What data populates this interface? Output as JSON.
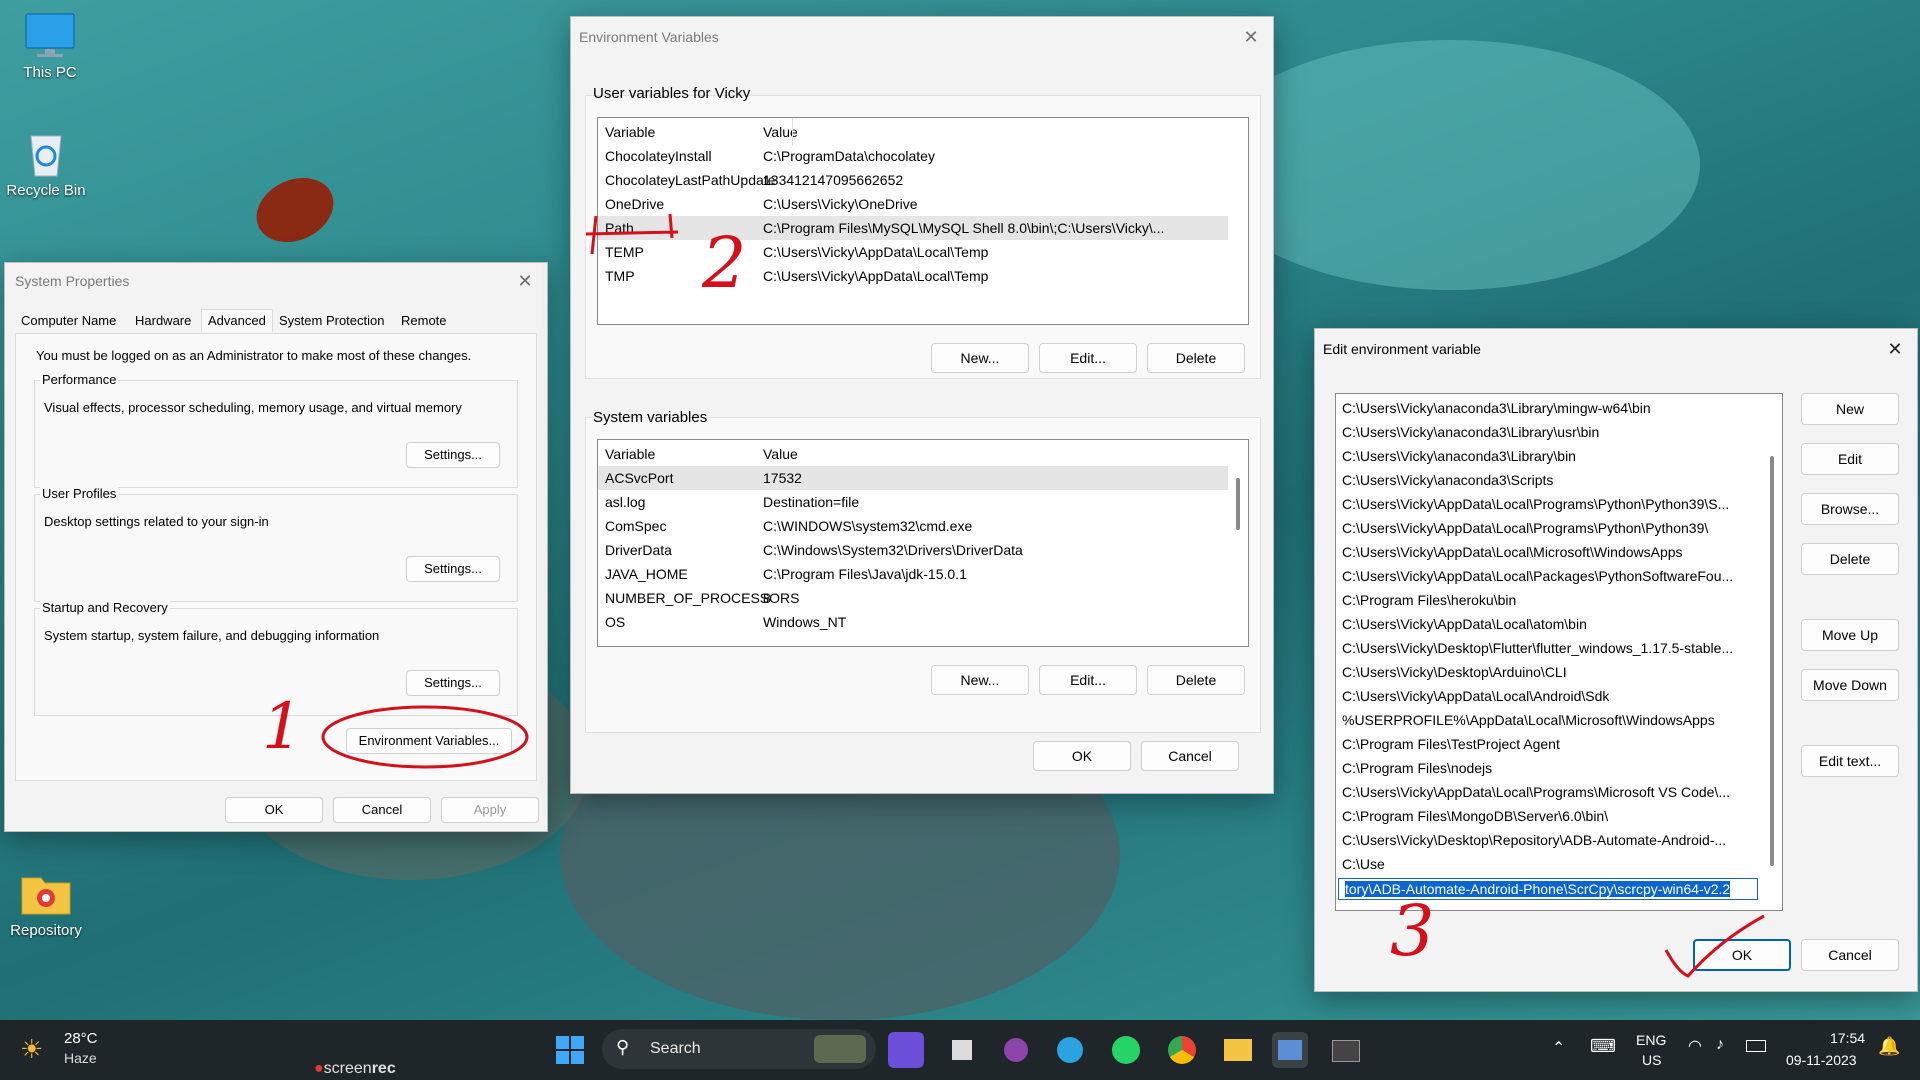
{
  "desktop": {
    "icons": [
      {
        "label": "This PC",
        "icon": "monitor-icon"
      },
      {
        "label": "Recycle Bin",
        "icon": "recycle-bin-icon"
      },
      {
        "label": "Repository",
        "icon": "folder-icon"
      }
    ]
  },
  "system_properties": {
    "title": "System Properties",
    "tabs": [
      "Computer Name",
      "Hardware",
      "Advanced",
      "System Protection",
      "Remote"
    ],
    "active_tab": "Advanced",
    "admin_note": "You must be logged on as an Administrator to make most of these changes.",
    "performance": {
      "title": "Performance",
      "desc": "Visual effects, processor scheduling, memory usage, and virtual memory",
      "button": "Settings..."
    },
    "user_profiles": {
      "title": "User Profiles",
      "desc": "Desktop settings related to your sign-in",
      "button": "Settings..."
    },
    "startup": {
      "title": "Startup and Recovery",
      "desc": "System startup, system failure, and debugging information",
      "button": "Settings..."
    },
    "env_button": "Environment Variables...",
    "ok": "OK",
    "cancel": "Cancel",
    "apply": "Apply"
  },
  "env_vars": {
    "title": "Environment Variables",
    "user_section": "User variables for Vicky",
    "system_section": "System variables",
    "col_variable": "Variable",
    "col_value": "Value",
    "user_rows": [
      {
        "name": "ChocolateyInstall",
        "value": "C:\\ProgramData\\chocolatey"
      },
      {
        "name": "ChocolateyLastPathUpdate",
        "value": "133412147095662652"
      },
      {
        "name": "OneDrive",
        "value": "C:\\Users\\Vicky\\OneDrive"
      },
      {
        "name": "Path",
        "value": "C:\\Program Files\\MySQL\\MySQL Shell 8.0\\bin\\;C:\\Users\\Vicky\\..."
      },
      {
        "name": "TEMP",
        "value": "C:\\Users\\Vicky\\AppData\\Local\\Temp"
      },
      {
        "name": "TMP",
        "value": "C:\\Users\\Vicky\\AppData\\Local\\Temp"
      }
    ],
    "system_rows": [
      {
        "name": "ACSvcPort",
        "value": "17532"
      },
      {
        "name": "asl.log",
        "value": "Destination=file"
      },
      {
        "name": "ComSpec",
        "value": "C:\\WINDOWS\\system32\\cmd.exe"
      },
      {
        "name": "DriverData",
        "value": "C:\\Windows\\System32\\Drivers\\DriverData"
      },
      {
        "name": "JAVA_HOME",
        "value": "C:\\Program Files\\Java\\jdk-15.0.1"
      },
      {
        "name": "NUMBER_OF_PROCESSORS",
        "value": "8"
      },
      {
        "name": "OS",
        "value": "Windows_NT"
      }
    ],
    "new": "New...",
    "edit": "Edit...",
    "delete": "Delete",
    "ok": "OK",
    "cancel": "Cancel"
  },
  "edit_env": {
    "title": "Edit environment variable",
    "entries": [
      "C:\\Users\\Vicky\\anaconda3\\Library\\mingw-w64\\bin",
      "C:\\Users\\Vicky\\anaconda3\\Library\\usr\\bin",
      "C:\\Users\\Vicky\\anaconda3\\Library\\bin",
      "C:\\Users\\Vicky\\anaconda3\\Scripts",
      "C:\\Users\\Vicky\\AppData\\Local\\Programs\\Python\\Python39\\S...",
      "C:\\Users\\Vicky\\AppData\\Local\\Programs\\Python\\Python39\\",
      "C:\\Users\\Vicky\\AppData\\Local\\Microsoft\\WindowsApps",
      "C:\\Users\\Vicky\\AppData\\Local\\Packages\\PythonSoftwareFou...",
      "C:\\Program Files\\heroku\\bin",
      "C:\\Users\\Vicky\\AppData\\Local\\atom\\bin",
      "C:\\Users\\Vicky\\Desktop\\Flutter\\flutter_windows_1.17.5-stable...",
      "C:\\Users\\Vicky\\Desktop\\Arduino\\CLI",
      "C:\\Users\\Vicky\\AppData\\Local\\Android\\Sdk",
      "%USERPROFILE%\\AppData\\Local\\Microsoft\\WindowsApps",
      "C:\\Program Files\\TestProject Agent",
      "C:\\Program Files\\nodejs",
      "C:\\Users\\Vicky\\AppData\\Local\\Programs\\Microsoft VS Code\\...",
      "C:\\Program Files\\MongoDB\\Server\\6.0\\bin\\",
      "C:\\Users\\Vicky\\Desktop\\Repository\\ADB-Automate-Android-...",
      "C:\\Use"
    ],
    "editing_value": "tory\\ADB-Automate-Android-Phone\\ScrCpy\\scrcpy-win64-v2.2",
    "buttons": {
      "new": "New",
      "edit": "Edit",
      "browse": "Browse...",
      "delete": "Delete",
      "move_up": "Move Up",
      "move_down": "Move Down",
      "edit_text": "Edit text..."
    },
    "ok": "OK",
    "cancel": "Cancel"
  },
  "annotations": {
    "one": "1",
    "two": "2",
    "three": "3"
  },
  "taskbar": {
    "weather_temp": "28°C",
    "weather_desc": "Haze",
    "search_placeholder": "Search",
    "watermark_a": "screen",
    "watermark_b": "rec",
    "lang": "ENG",
    "region": "US",
    "time": "17:54",
    "date": "09-11-2023",
    "apps": [
      "start-icon",
      "mail-icon",
      "files-icon",
      "github-icon",
      "telegram-icon",
      "whatsapp-icon",
      "chrome-icon",
      "file-explorer-icon",
      "system-properties-icon",
      "terminal-icon"
    ]
  },
  "colors": {
    "accent": "#005fb8",
    "selection": "#0a64d2",
    "ink": "#d4111b",
    "taskbar": "#1f2629"
  }
}
